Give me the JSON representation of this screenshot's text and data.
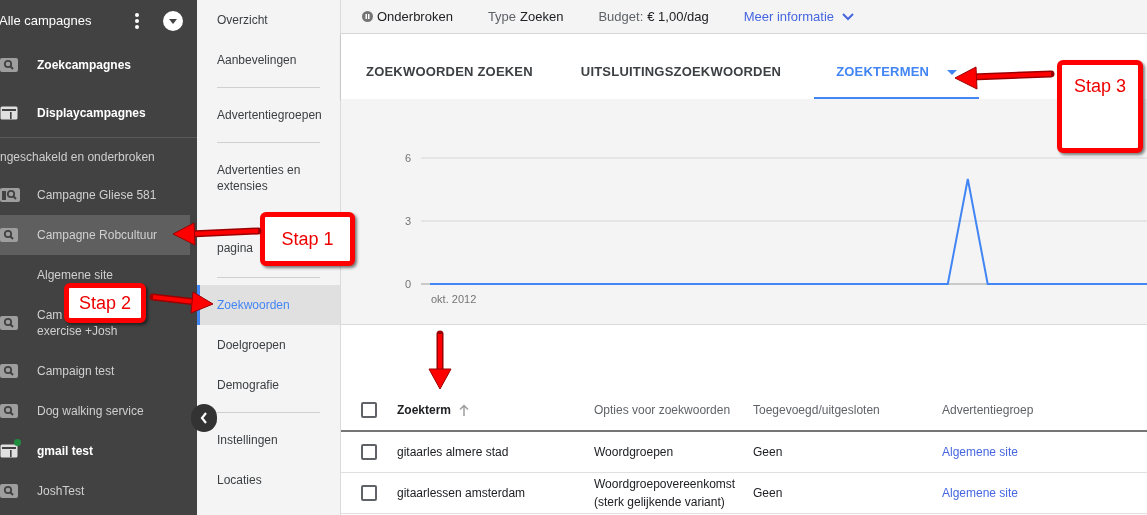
{
  "sidebar": {
    "title": "Alle campagnes",
    "items": [
      {
        "kind": "search",
        "group": true,
        "label": "Zoekcampagnes",
        "selected": false,
        "active": false
      },
      {
        "kind": "display",
        "group": true,
        "label": "Displaycampagnes",
        "selected": false,
        "active": false
      },
      {
        "kind": "section",
        "label": "ngeschakeld en onderbroken"
      },
      {
        "kind": "mixed",
        "group": false,
        "label": "Campagne Gliese 581",
        "selected": false,
        "active": false
      },
      {
        "kind": "search",
        "group": false,
        "label": "Campagne Robcultuur",
        "selected": true,
        "active": false
      },
      {
        "kind": "adgroup",
        "group": false,
        "label": "Algemene site",
        "selected": false,
        "active": false
      },
      {
        "kind": "search",
        "group": false,
        "label": "Cam",
        "second_line": "exercise +Josh",
        "selected": false,
        "active": false
      },
      {
        "kind": "search",
        "group": false,
        "label": "Campaign test",
        "selected": false,
        "active": false
      },
      {
        "kind": "search",
        "group": false,
        "label": "Dog walking service",
        "selected": false,
        "active": false
      },
      {
        "kind": "display",
        "group": false,
        "label": "gmail test",
        "selected": false,
        "active": true
      },
      {
        "kind": "search",
        "group": false,
        "label": "JoshTest",
        "selected": false,
        "active": false
      }
    ]
  },
  "nav": {
    "items": [
      {
        "kind": "link",
        "label": "Overzicht",
        "selected": false
      },
      {
        "kind": "link",
        "label": "Aanbevelingen",
        "selected": false
      },
      {
        "kind": "divider"
      },
      {
        "kind": "link",
        "label": "Advertentiegroepen",
        "selected": false
      },
      {
        "kind": "divider"
      },
      {
        "kind": "link",
        "label": "Advertenties en extensies",
        "selected": false
      },
      {
        "kind": "link",
        "label": "pagina",
        "covered": true,
        "selected": false
      },
      {
        "kind": "divider"
      },
      {
        "kind": "link",
        "label": "Zoekwoorden",
        "selected": true
      },
      {
        "kind": "link",
        "label": "Doelgroepen",
        "selected": false
      },
      {
        "kind": "link",
        "label": "Demografie",
        "selected": false
      },
      {
        "kind": "divider"
      },
      {
        "kind": "link",
        "label": "Instellingen",
        "selected": false
      },
      {
        "kind": "link",
        "label": "Locaties",
        "selected": false
      }
    ]
  },
  "summary": {
    "status": "Onderbroken",
    "type_label": "Type",
    "type_value": "Zoeken",
    "budget_label": "Budget:",
    "budget_value": "€ 1,00/dag",
    "more_link": "Meer informatie"
  },
  "tabs": [
    {
      "label": "ZOEKWOORDEN ZOEKEN",
      "selected": false,
      "has_menu": false
    },
    {
      "label": "UITSLUITINGSZOEKWOORDEN",
      "selected": false,
      "has_menu": false
    },
    {
      "label": "ZOEKTERMEN",
      "selected": true,
      "has_menu": true
    }
  ],
  "chart": {
    "chart_data": {
      "type": "line",
      "series": [
        {
          "color": "#4285f4",
          "values": [
            0,
            0,
            0,
            0,
            0,
            0,
            0,
            0,
            0,
            0,
            0,
            0,
            0,
            0,
            0,
            0,
            0,
            0,
            0,
            0,
            0,
            0,
            0,
            0,
            0,
            0,
            0,
            5,
            0,
            0,
            0,
            0,
            0,
            0,
            0,
            0,
            0
          ]
        }
      ],
      "ylim": [
        0,
        6
      ],
      "yticks": [
        0,
        3,
        6
      ],
      "annotations": [
        {
          "text": "okt. 2012"
        }
      ]
    }
  },
  "table": {
    "select_all_checked": false,
    "columns": [
      {
        "label": "Zoekterm",
        "sorted": true
      },
      {
        "label": "Opties voor zoekwoorden",
        "sorted": false
      },
      {
        "label": "Toegevoegd/uitgesloten",
        "sorted": false
      },
      {
        "label": "Advertentiegroep",
        "sorted": false
      }
    ],
    "rows": [
      {
        "checked": false,
        "cells": [
          "gitaarles almere stad",
          "Woordgroepen",
          "Geen",
          "Algemene site"
        ]
      },
      {
        "checked": false,
        "cells": [
          "gitaarlessen amsterdam",
          "Woordgroepovereenkomst\n(sterk gelijkende variant)",
          "Geen",
          "Algemene site"
        ]
      }
    ]
  },
  "annotations": [
    {
      "kind": "callout",
      "text": "Stap 1"
    },
    {
      "kind": "callout",
      "text": "Stap 2"
    },
    {
      "kind": "callout",
      "text": "Stap 3"
    }
  ]
}
